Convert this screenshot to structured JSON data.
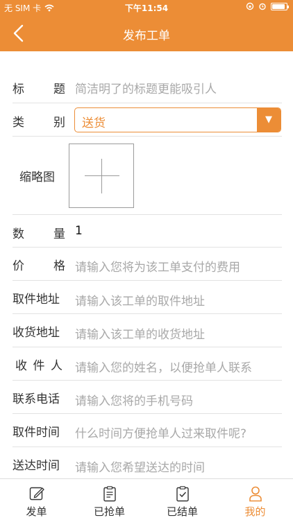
{
  "status": {
    "carrier": "无 SIM 卡",
    "time": "下午11:54"
  },
  "nav": {
    "title": "发布工单"
  },
  "form": {
    "title": {
      "label_chars": [
        "标",
        "题"
      ],
      "placeholder": "简洁明了的标题更能吸引人"
    },
    "category": {
      "label_chars": [
        "类",
        "别"
      ],
      "value": "送货",
      "arrow": "▼"
    },
    "thumbnail": {
      "label": "缩略图"
    },
    "quantity": {
      "label_chars": [
        "数",
        "量"
      ],
      "value": "1"
    },
    "price": {
      "label_chars": [
        "价",
        "格"
      ],
      "placeholder": "请输入您将为该工单支付的费用"
    },
    "pickup_address": {
      "label": "取件地址",
      "placeholder": "请输入该工单的取件地址"
    },
    "delivery_address": {
      "label": "收货地址",
      "placeholder": "请输入该工单的收货地址"
    },
    "receiver": {
      "label_chars": [
        "收",
        "件",
        "人"
      ],
      "placeholder": "请输入您的姓名，以便抢单人联系"
    },
    "phone": {
      "label": "联系电话",
      "placeholder": "请输入您将的手机号码"
    },
    "pickup_time": {
      "label": "取件时间",
      "placeholder": "什么时间方便抢单人过来取件呢?"
    },
    "delivery_time": {
      "label": "送达时间",
      "placeholder": "请输入您希望送达的时间"
    }
  },
  "tabbar": {
    "items": [
      {
        "label": "发单",
        "icon": "edit-icon"
      },
      {
        "label": "已抢单",
        "icon": "clipboard-icon"
      },
      {
        "label": "已结单",
        "icon": "clipboard-check-icon"
      },
      {
        "label": "我的",
        "icon": "user-icon",
        "active": true
      }
    ]
  },
  "colors": {
    "accent": "#ec8d36",
    "placeholder": "#a8a8a8",
    "divider": "#e2e2e2"
  }
}
